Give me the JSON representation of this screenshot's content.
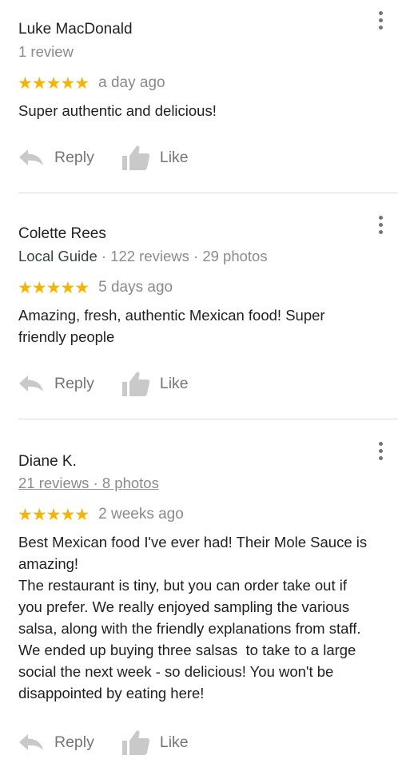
{
  "reviews": [
    {
      "name": "Luke MacDonald",
      "meta": "1 review",
      "stars": "★★★★★",
      "rating": 5,
      "date": "a day ago",
      "text": "Super authentic and delicious!",
      "reply_label": "Reply",
      "like_label": "Like"
    },
    {
      "name": "Colette Rees",
      "meta_guide": "Local Guide",
      "meta_rest": " · 122 reviews · 29 photos",
      "stars": "★★★★★",
      "rating": 5,
      "date": "5 days ago",
      "text": "Amazing, fresh, authentic Mexican food! Super\nfriendly people",
      "reply_label": "Reply",
      "like_label": "Like"
    },
    {
      "name": "Diane K.",
      "meta_linked": "21 reviews · 8 photos",
      "stars": "★★★★★",
      "rating": 5,
      "date": "2 weeks ago",
      "text": "Best Mexican food I've ever had! Their Mole Sauce is\namazing!\nThe restaurant is tiny, but you can order take out if\nyou prefer. We really enjoyed sampling the various\nsalsa, along with the friendly explanations from staff.\nWe ended up buying three salsas  to take to a large\nsocial the next week - so delicious! You won't be\ndisappointed by eating here!",
      "reply_label": "Reply",
      "like_label": "Like"
    }
  ],
  "icons": {
    "menu": "more-vert-icon",
    "reply": "reply-icon",
    "like": "thumb-up-icon"
  },
  "colors": {
    "star": "#f4b400",
    "action_icon": "#c9c9c9",
    "secondary_text": "#8a8a8a"
  }
}
